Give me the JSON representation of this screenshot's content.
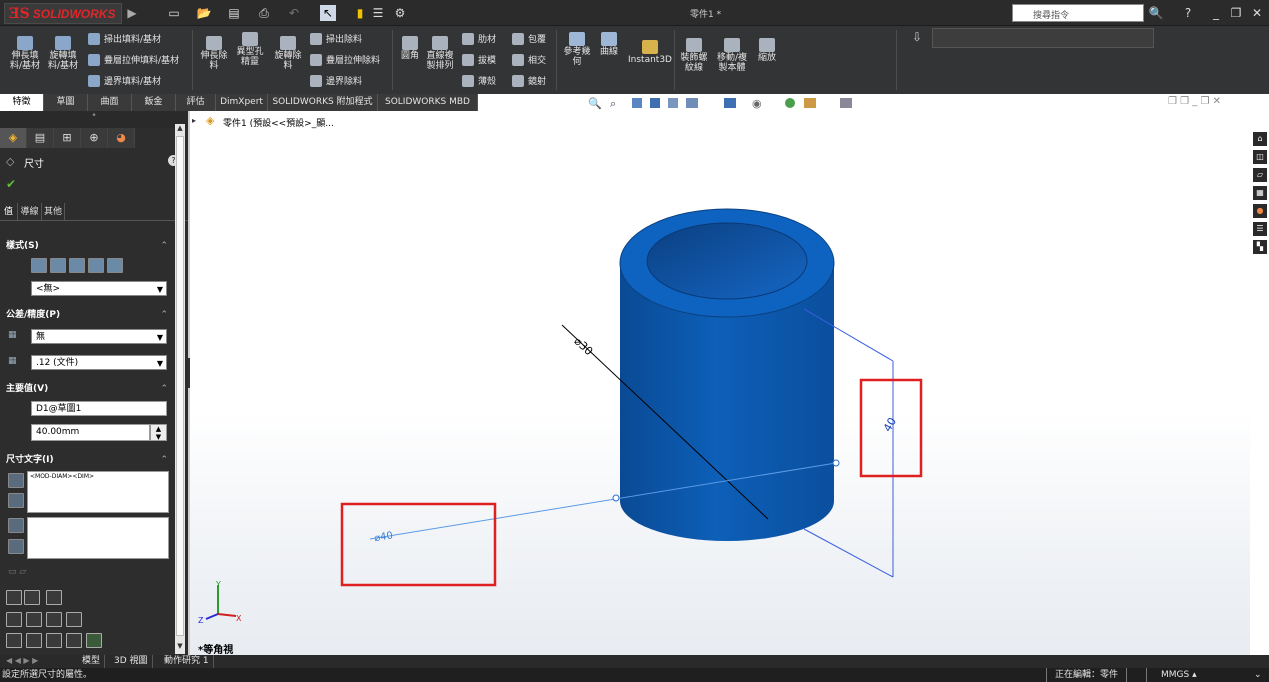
{
  "app": {
    "brand": "SOLIDWORKS",
    "doc_title": "零件1 *",
    "search_placeholder": "搜尋指令"
  },
  "ribbon": {
    "extrude_boss": "伸長填料/基材",
    "revolve_boss": "旋轉填料/基材",
    "sweep_boss": "掃出填料/基材",
    "loft_boss": "疊層拉伸填料/基材",
    "boundary_boss": "邊界填料/基材",
    "extrude_cut": "伸長除料",
    "hole_wizard": "異型孔精靈",
    "revolve_cut": "旋轉除料",
    "sweep_cut": "掃出除料",
    "loft_cut": "疊層拉伸除料",
    "boundary_cut": "邊界除料",
    "fillet": "圓角",
    "linear_pattern": "直線複製排列",
    "rib": "肋材",
    "draft": "拔模",
    "shell": "薄殼",
    "wrap": "包覆",
    "intersect": "相交",
    "mirror": "鏡射",
    "ref_geometry": "參考幾何",
    "curves": "曲線",
    "instant3d": "Instant3D",
    "cosmetic_thread": "裝飾螺紋線",
    "move_copy": "移動/複製本體",
    "scale": "縮放"
  },
  "cmd_tabs": [
    "特徵",
    "草圖",
    "曲面",
    "鈑金",
    "評估",
    "DimXpert",
    "SOLIDWORKS 附加程式",
    "SOLIDWORKS MBD"
  ],
  "tree": {
    "root": "零件1 (預設<<預設>_顯..."
  },
  "property_manager": {
    "title": "尺寸",
    "subtabs": [
      "值",
      "導線",
      "其他"
    ],
    "style_section": "樣式(S)",
    "style_value": "<無>",
    "tolerance_section": "公差/精度(P)",
    "tolerance_value": "無",
    "precision_value": ".12 (文件)",
    "primary_section": "主要值(V)",
    "primary_name": "D1@草圖1",
    "primary_value": "40.00mm",
    "dim_text_section": "尺寸文字(I)",
    "dim_text_value": "<MOD-DIAM><DIM>"
  },
  "viewport": {
    "view_name": "*等角視",
    "dim_diag": "⌀30",
    "dim_bottom": "⌀40",
    "dim_height": "40"
  },
  "bottom_tabs": [
    "模型",
    "3D 視圖",
    "動作研究 1"
  ],
  "status": {
    "left": "設定所選尺寸的屬性。",
    "editing": "正在編輯：零件",
    "units": "MMGS"
  },
  "colors": {
    "cylinder": "#0d5fb8",
    "cylinder_dark": "#0a4a94",
    "dimension_line": "#3a5fe0",
    "highlight_box": "#e02020"
  }
}
